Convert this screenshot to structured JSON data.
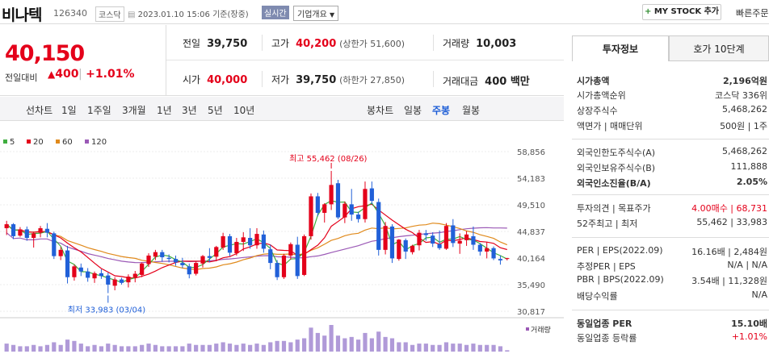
{
  "header": {
    "name": "비나텍",
    "code": "126340",
    "market": "코스닥",
    "datetime": "2023.01.10 15:06 기준(장중)",
    "realtime": "실시간",
    "company_info": "기업개요",
    "my_stock": "MY STOCK 추가",
    "quick": "빠른주문"
  },
  "price": {
    "current": "40,150",
    "change_label": "전일대비",
    "change": "400",
    "change_pct": "+1.01%"
  },
  "quote": {
    "prev_label": "전일",
    "prev": "39,750",
    "high_label": "고가",
    "high": "40,200",
    "upper_limit": "(상한가 51,600)",
    "volume_label": "거래량",
    "volume": "10,003",
    "open_label": "시가",
    "open": "40,000",
    "low_label": "저가",
    "low": "39,750",
    "lower_limit": "(하한가 27,850)",
    "amount_label": "거래대금",
    "amount": "400 백만"
  },
  "tabs": {
    "line_label": "선차트",
    "line": [
      "1일",
      "1주일",
      "3개월",
      "1년",
      "3년",
      "5년",
      "10년"
    ],
    "candle_label": "봉차트",
    "candle": [
      "일봉",
      "주봉",
      "월봉"
    ],
    "selected": "주봉"
  },
  "chart_data": {
    "type": "candlestick",
    "ma_legend": [
      {
        "name": "5",
        "color": "#3fae3f"
      },
      {
        "name": "20",
        "color": "#e4001a"
      },
      {
        "name": "60",
        "color": "#e08a1c"
      },
      {
        "name": "120",
        "color": "#9b59b6"
      }
    ],
    "y_ticks": [
      "58,856",
      "54,183",
      "49,510",
      "44,837",
      "40,164",
      "35,490",
      "30,817"
    ],
    "ylim": [
      30817,
      58856
    ],
    "high_annot": "최고 55,462 (08/26)",
    "low_annot": "최저 33,983 (03/04)",
    "volume_label": "거래량",
    "candles": [
      [
        45400,
        46700,
        44200,
        46100
      ],
      [
        46100,
        46300,
        43500,
        44000
      ],
      [
        44100,
        45600,
        43900,
        45200
      ],
      [
        45200,
        45700,
        43200,
        43700
      ],
      [
        43700,
        44800,
        42000,
        44500
      ],
      [
        44600,
        45800,
        43800,
        45400
      ],
      [
        45300,
        46300,
        43800,
        44600
      ],
      [
        44500,
        44800,
        40000,
        40500
      ],
      [
        40500,
        42100,
        39800,
        41600
      ],
      [
        41500,
        42300,
        35700,
        36800
      ],
      [
        36800,
        39000,
        36200,
        38700
      ],
      [
        38500,
        39200,
        37000,
        37800
      ],
      [
        37800,
        38400,
        36000,
        36700
      ],
      [
        36600,
        37800,
        35800,
        37500
      ],
      [
        37500,
        38200,
        36500,
        37000
      ],
      [
        37100,
        37600,
        34000,
        35500
      ],
      [
        35300,
        36800,
        34500,
        36400
      ],
      [
        36400,
        36700,
        35500,
        35800
      ],
      [
        35900,
        37300,
        35000,
        36900
      ],
      [
        36700,
        37900,
        35900,
        37400
      ],
      [
        37200,
        39400,
        36800,
        39200
      ],
      [
        39100,
        41000,
        38600,
        40600
      ],
      [
        40400,
        41600,
        39800,
        41200
      ],
      [
        41200,
        41600,
        39500,
        40300
      ],
      [
        40200,
        40800,
        39400,
        40000
      ],
      [
        40000,
        40600,
        38800,
        39400
      ],
      [
        39300,
        40200,
        38400,
        38900
      ],
      [
        38700,
        39200,
        36600,
        37300
      ],
      [
        37400,
        39600,
        37100,
        39300
      ],
      [
        39200,
        40700,
        38500,
        40500
      ],
      [
        40500,
        41900,
        39400,
        40200
      ],
      [
        40400,
        42300,
        39600,
        42100
      ],
      [
        42000,
        44600,
        41600,
        44000
      ],
      [
        44000,
        44400,
        40500,
        41100
      ],
      [
        41000,
        43700,
        40600,
        43000
      ],
      [
        43000,
        44700,
        41400,
        43800
      ],
      [
        43700,
        45400,
        41800,
        42400
      ],
      [
        42400,
        45400,
        41800,
        44400
      ],
      [
        44300,
        45000,
        41100,
        41800
      ],
      [
        41700,
        42500,
        38200,
        39300
      ],
      [
        39300,
        39800,
        36300,
        36800
      ],
      [
        36800,
        40900,
        36500,
        40600
      ],
      [
        40600,
        42900,
        39900,
        42600
      ],
      [
        42500,
        43900,
        36500,
        37000
      ],
      [
        37200,
        44300,
        37000,
        44000
      ],
      [
        44000,
        51500,
        43400,
        51000
      ],
      [
        51000,
        51600,
        47500,
        48100
      ],
      [
        48100,
        49800,
        46400,
        49600
      ],
      [
        49600,
        55462,
        48600,
        53000
      ],
      [
        53300,
        53900,
        47000,
        47300
      ],
      [
        47300,
        50100,
        46300,
        49700
      ],
      [
        49600,
        52300,
        46700,
        47800
      ],
      [
        47800,
        48300,
        46400,
        47000
      ],
      [
        47000,
        53600,
        46400,
        52300
      ],
      [
        52400,
        53600,
        49600,
        50200
      ],
      [
        50000,
        50600,
        40600,
        41600
      ],
      [
        41600,
        46500,
        40800,
        45800
      ],
      [
        45700,
        46100,
        39300,
        40100
      ],
      [
        40000,
        43500,
        39700,
        43400
      ],
      [
        43300,
        43600,
        40000,
        41300
      ],
      [
        41200,
        42500,
        40800,
        42300
      ],
      [
        42400,
        45100,
        41500,
        44600
      ],
      [
        44500,
        45100,
        43200,
        44200
      ],
      [
        44100,
        44700,
        42100,
        42700
      ],
      [
        42600,
        45000,
        41600,
        41900
      ],
      [
        41800,
        46300,
        41600,
        45800
      ],
      [
        45900,
        47000,
        42100,
        42800
      ],
      [
        42700,
        44500,
        40900,
        43200
      ],
      [
        43300,
        44900,
        42300,
        44300
      ],
      [
        44000,
        45700,
        41600,
        42500
      ],
      [
        42500,
        42800,
        40600,
        41300
      ],
      [
        41300,
        43000,
        40100,
        41900
      ],
      [
        41900,
        42200,
        39800,
        40100
      ],
      [
        40000,
        40600,
        39000,
        39750
      ],
      [
        40000,
        40200,
        39750,
        40150
      ]
    ],
    "volumes": [
      6,
      5,
      4,
      4,
      5,
      4,
      5,
      7,
      5,
      9,
      8,
      6,
      4,
      5,
      4,
      6,
      5,
      4,
      4,
      4,
      5,
      6,
      5,
      4,
      4,
      4,
      4,
      6,
      5,
      5,
      5,
      6,
      7,
      6,
      5,
      6,
      5,
      6,
      5,
      7,
      8,
      8,
      7,
      9,
      10,
      18,
      14,
      12,
      20,
      12,
      10,
      11,
      9,
      14,
      10,
      15,
      11,
      10,
      7,
      7,
      5,
      6,
      6,
      5,
      5,
      7,
      6,
      6,
      5,
      6,
      5,
      5,
      5,
      4,
      1
    ]
  },
  "invest": {
    "tab1": "투자정보",
    "tab2": "호가 10단계",
    "rows": [
      {
        "l": "시가총액",
        "v": "2,196억원",
        "bold": true
      },
      {
        "l": "시가총액순위",
        "v": "코스닥 336위"
      },
      {
        "l": "상장주식수",
        "v": "5,468,262"
      },
      {
        "l": "액면가 | 매매단위",
        "v": "500원 | 1주"
      },
      {
        "l": "외국인한도주식수(A)",
        "v": "5,468,262"
      },
      {
        "l": "외국인보유주식수(B)",
        "v": "111,888"
      },
      {
        "l": "외국인소진율(B/A)",
        "v": "2.05%",
        "bold": true
      },
      {
        "l": "투자의견 | 목표주가",
        "v": "4.00매수 | 68,731",
        "red": true
      },
      {
        "l": "52주최고 | 최저",
        "v": "55,462 | 33,983"
      },
      {
        "l": "PER | EPS(2022.09)",
        "v": "16.16배 | 2,484원"
      },
      {
        "l": "추정PER | EPS",
        "v": "N/A | N/A"
      },
      {
        "l": "PBR | BPS(2022.09)",
        "v": "3.54배 | 11,328원"
      },
      {
        "l": "배당수익률",
        "v": "N/A"
      },
      {
        "l": "동일업종 PER",
        "v": "15.10배",
        "bold": true
      },
      {
        "l": "동일업종 등락률",
        "v": "+1.01%",
        "red": true
      }
    ]
  }
}
